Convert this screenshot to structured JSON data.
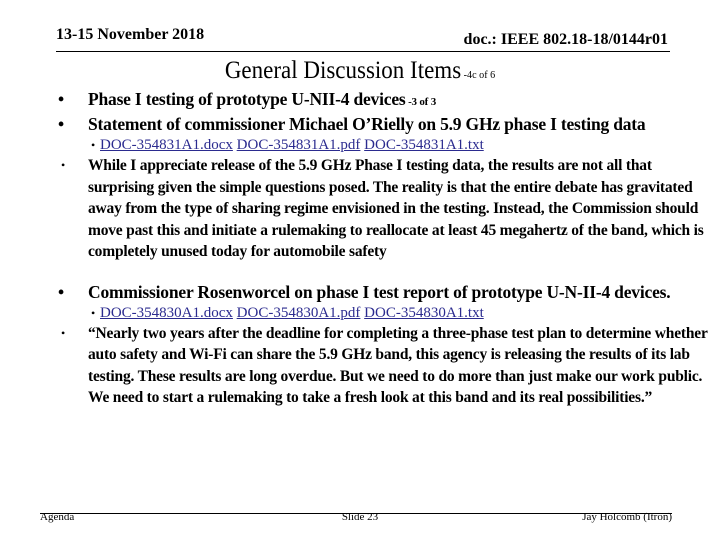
{
  "header": {
    "date": "13-15 November 2018",
    "doc": "doc.: IEEE 802.18-18/0144r01"
  },
  "title": {
    "main": "General Discussion Items",
    "suffix": " -4c of 6"
  },
  "items": [
    {
      "text": "Phase I testing of prototype U-NII-4 devices",
      "suffix": " -3 of 3"
    },
    {
      "text": "Statement of commissioner Michael O’Rielly on 5.9 GHz phase I testing data"
    }
  ],
  "links_1": [
    "DOC-354831A1.docx",
    "DOC-354831A1.pdf",
    "DOC-354831A1.txt"
  ],
  "quote_1": "While I appreciate release of the 5.9 GHz Phase I testing data, the results are not all that surprising given the simple questions posed.  The reality is that the entire debate has gravitated away from the type of sharing regime envisioned in the testing.  Instead, the Commission should move past this and initiate a rulemaking to reallocate at least 45 megahertz of the band, which is completely unused today for automobile safety",
  "item_3": "Commissioner Rosenworcel on phase I test report of prototype U-N-II-4 devices.",
  "links_2": [
    "DOC-354830A1.docx",
    "DOC-354830A1.pdf",
    "DOC-354830A1.txt"
  ],
  "quote_2": "“Nearly two years after the deadline for completing a three-phase test plan to determine whether auto safety and Wi-Fi can share the 5.9 GHz band, this agency is releasing the results of its lab testing.  These results are long overdue.  But we need to do more than just make our work public.  We need to start a rulemaking to take a fresh look at this band and its real possibilities.”",
  "bullet": "•",
  "footer": {
    "left": "Agenda",
    "center": "Slide 23",
    "right": "Jay Holcomb (Itron)"
  }
}
